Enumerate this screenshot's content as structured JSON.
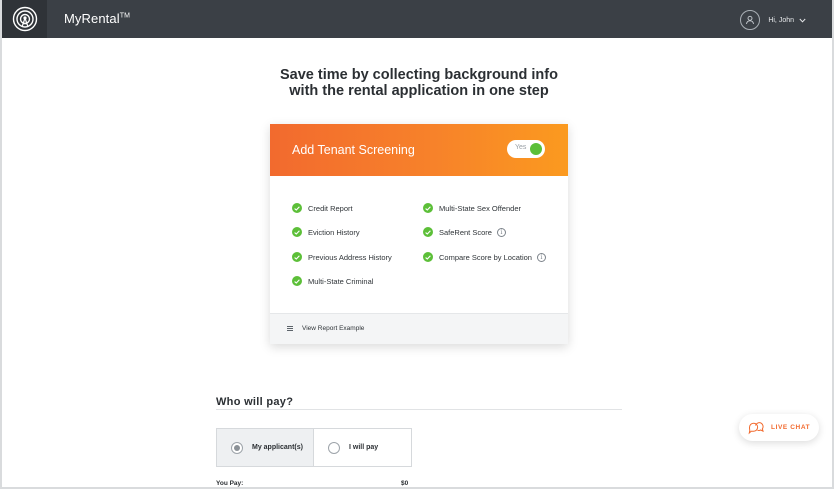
{
  "header": {
    "app_name": "MyRental",
    "trademark": "TM",
    "greeting": "Hi, John",
    "logo_icon": "signal-tower-logo-icon",
    "avatar_icon": "user-avatar-icon",
    "chevron_icon": "chevron-down-icon"
  },
  "main": {
    "headline_line1": "Save time by collecting background info",
    "headline_line2": "with the rental application in one step"
  },
  "screening_card": {
    "title": "Add Tenant Screening",
    "toggle_label": "Yes",
    "toggle_on": true,
    "features_left": [
      "Credit Report",
      "Eviction History",
      "Previous Address History",
      "Multi-State Criminal"
    ],
    "features_right": [
      "Multi-State Sex Offender",
      "SafeRent Score",
      "Compare Score by Location"
    ],
    "report_link": "View Report Example",
    "colors": {
      "header_start": "#f26a2e",
      "header_end": "#fb9a1f",
      "check": "#5cbf38"
    }
  },
  "payment": {
    "title": "Who will pay?",
    "options": [
      "My applicant(s)",
      "I will pay"
    ],
    "selected_index": 0,
    "you_pay_label": "You Pay:",
    "you_pay_amount": "$0"
  },
  "live_chat": {
    "label": "LIVE CHAT",
    "icon": "chat-bubbles-icon",
    "color": "#f26a2e"
  }
}
